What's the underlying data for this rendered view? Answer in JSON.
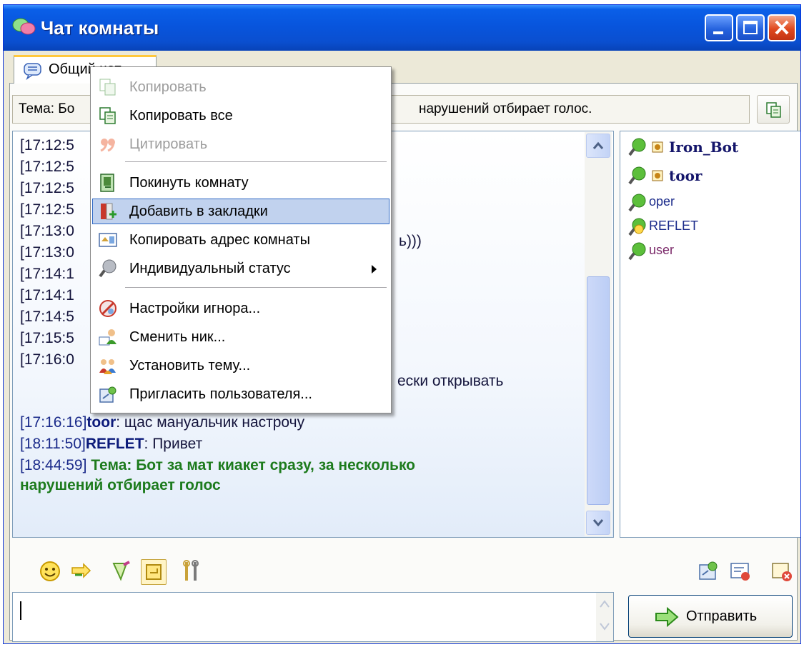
{
  "window": {
    "title": "Чат комнаты"
  },
  "tab": {
    "label": "Общий чат"
  },
  "topic": {
    "prefix": "Тема: Бо",
    "suffix": "нарушений отбирает голос."
  },
  "chat": {
    "hidden_timestamps": [
      "[17:12:5",
      "[17:12:5",
      "[17:12:5",
      "[17:12:5",
      "[17:13:0",
      "[17:13:0",
      "[17:14:1",
      "[17:14:1",
      "[17:14:5",
      "[17:15:5",
      "[17:16:0"
    ],
    "fragments": {
      "smiley": "ь)))",
      "long_text": "ески открывать"
    },
    "messages": [
      {
        "time": "[17:16:16]",
        "nick": "toor",
        "text": ": щас мануальчик настрочу"
      },
      {
        "time": "[18:11:50]",
        "nick": "REFLET",
        "text": ": Привет"
      },
      {
        "time": "[18:44:59]",
        "topic_line1": "Тема: Бот за мат киакет сразу, за несколько",
        "topic_line2": "нарушений отбирает голос"
      }
    ]
  },
  "users": [
    {
      "name": "Iron_Bot",
      "role": "moderator",
      "color": "#14156a"
    },
    {
      "name": "toor",
      "role": "moderator",
      "color": "#14156a"
    },
    {
      "name": "oper",
      "role": "participant",
      "color": "#1a2a8a"
    },
    {
      "name": "REFLET",
      "role": "participant",
      "color": "#1a2a8a"
    },
    {
      "name": "user",
      "role": "participant",
      "color": "#7b2a6a"
    }
  ],
  "context_menu": {
    "items": [
      {
        "label": "Копировать",
        "icon": "copy-icon",
        "enabled": false
      },
      {
        "label": "Копировать все",
        "icon": "copy-all-icon",
        "enabled": true
      },
      {
        "label": "Цитировать",
        "icon": "quote-icon",
        "enabled": false
      },
      {
        "label": "Покинуть комнату",
        "icon": "leave-room-icon",
        "enabled": true
      },
      {
        "label": "Добавить в закладки",
        "icon": "bookmark-icon",
        "enabled": true,
        "highlighted": true
      },
      {
        "label": "Копировать адрес комнаты",
        "icon": "room-address-icon",
        "enabled": true
      },
      {
        "label": "Индивидуальный статус",
        "icon": "status-icon",
        "enabled": true,
        "submenu": true
      },
      {
        "label": "Настройки игнора...",
        "icon": "ignore-icon",
        "enabled": true
      },
      {
        "label": "Сменить ник...",
        "icon": "nick-icon",
        "enabled": true
      },
      {
        "label": "Установить тему...",
        "icon": "set-topic-icon",
        "enabled": true
      },
      {
        "label": "Пригласить пользователя...",
        "icon": "invite-icon",
        "enabled": true
      }
    ]
  },
  "send_button": {
    "label": "Отправить"
  },
  "colors": {
    "titlebar": "#0855dd",
    "menu_highlight": "#c1d2ee",
    "topic_message": "#1d7b1d",
    "accent_tab": "#ffc83c"
  }
}
